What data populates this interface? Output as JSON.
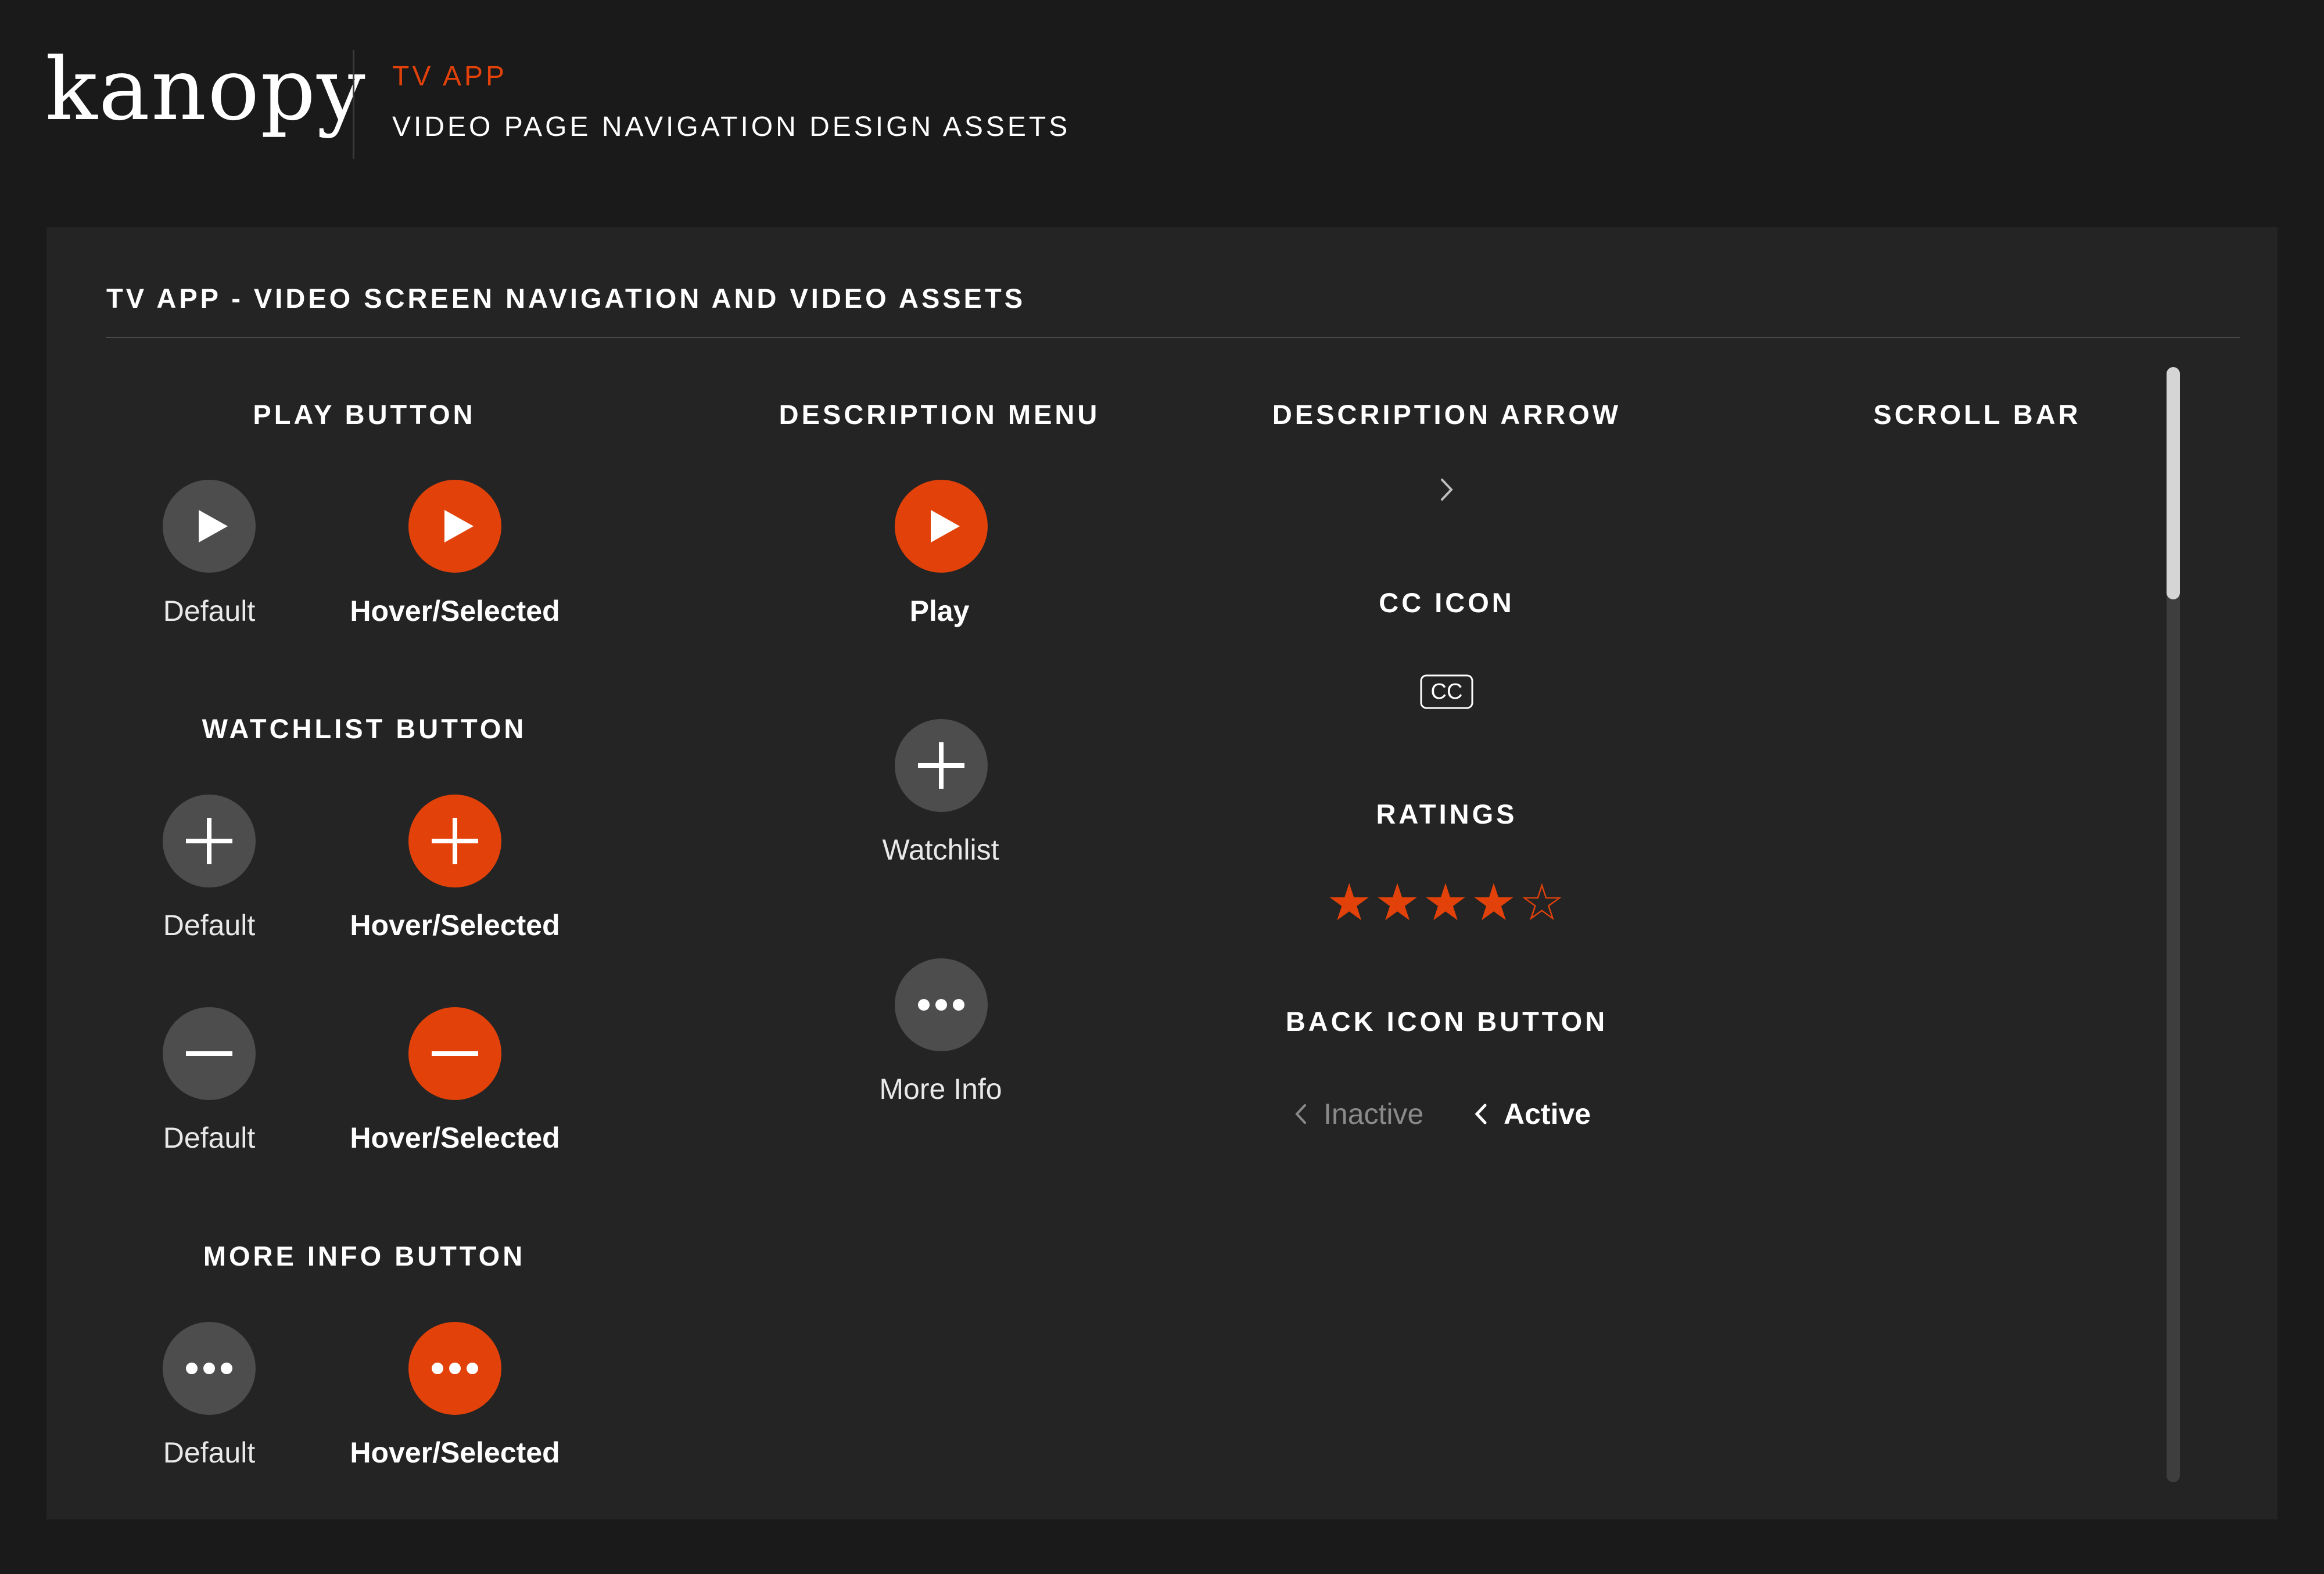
{
  "header": {
    "logo": "kanopy",
    "subtitle": "TV APP",
    "title": "VIDEO PAGE NAVIGATION DESIGN ASSETS"
  },
  "panel": {
    "title": "TV APP - VIDEO SCREEN NAVIGATION AND VIDEO ASSETS"
  },
  "play_button": {
    "heading": "PLAY BUTTON",
    "default_label": "Default",
    "hover_label": "Hover/Selected"
  },
  "watchlist_button": {
    "heading": "WATCHLIST BUTTON",
    "add_default_label": "Default",
    "add_hover_label": "Hover/Selected",
    "remove_default_label": "Default",
    "remove_hover_label": "Hover/Selected"
  },
  "more_info_button": {
    "heading": "MORE INFO BUTTON",
    "default_label": "Default",
    "hover_label": "Hover/Selected"
  },
  "description_menu": {
    "heading": "DESCRIPTION MENU",
    "items": [
      {
        "label": "Play"
      },
      {
        "label": "Watchlist"
      },
      {
        "label": "More Info"
      }
    ]
  },
  "description_arrow": {
    "heading": "DESCRIPTION ARROW",
    "glyph": ">"
  },
  "cc_icon": {
    "heading": "CC ICON",
    "text": "CC"
  },
  "ratings": {
    "heading": "RATINGS",
    "filled": 4,
    "total": 5,
    "stars_text": "★★★★☆"
  },
  "back_icon_button": {
    "heading": "BACK ICON BUTTON",
    "inactive_label": "Inactive",
    "active_label": "Active"
  },
  "scroll_bar": {
    "heading": "SCROLL BAR"
  },
  "colors": {
    "background": "#1a1a1a",
    "panel": "#242424",
    "accent": "#e2420a",
    "button_default": "#4d4d4d",
    "text": "#ffffff"
  },
  "icons": [
    "play-icon",
    "plus-icon",
    "minus-icon",
    "more-dots-icon",
    "chevron-right-icon",
    "cc-icon",
    "star-icon",
    "chevron-left-icon"
  ]
}
